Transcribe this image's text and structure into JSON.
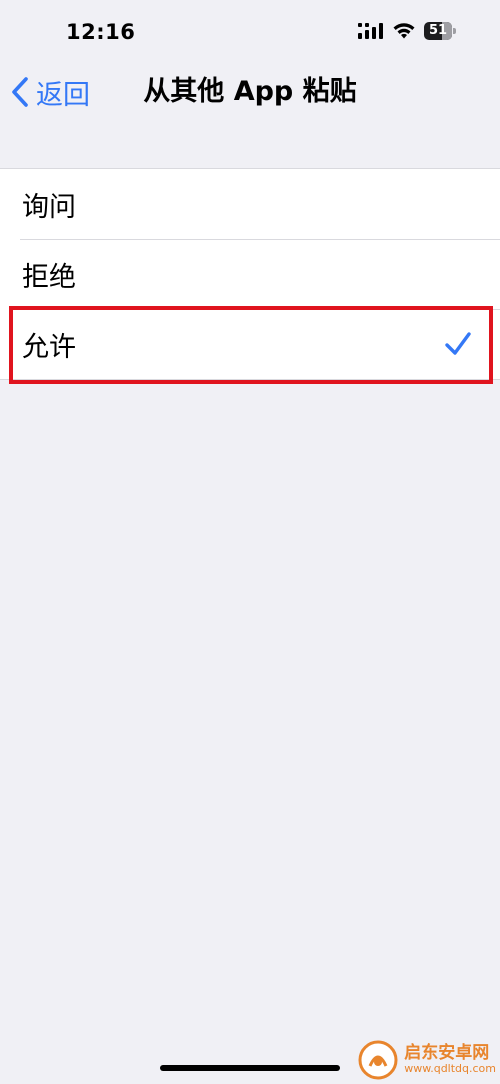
{
  "status_bar": {
    "time": "12:16",
    "battery": "51"
  },
  "nav": {
    "back_label": "返回",
    "title": "从其他 App 粘贴"
  },
  "options": [
    {
      "label": "询问",
      "selected": false
    },
    {
      "label": "拒绝",
      "selected": false
    },
    {
      "label": "允许",
      "selected": true
    }
  ],
  "watermark": {
    "name": "启东安卓网",
    "url": "www.qdltdq.com"
  },
  "colors": {
    "accent": "#3478f6",
    "highlight": "#e0141e",
    "background": "#f0f0f5",
    "watermark": "#e8852d"
  }
}
